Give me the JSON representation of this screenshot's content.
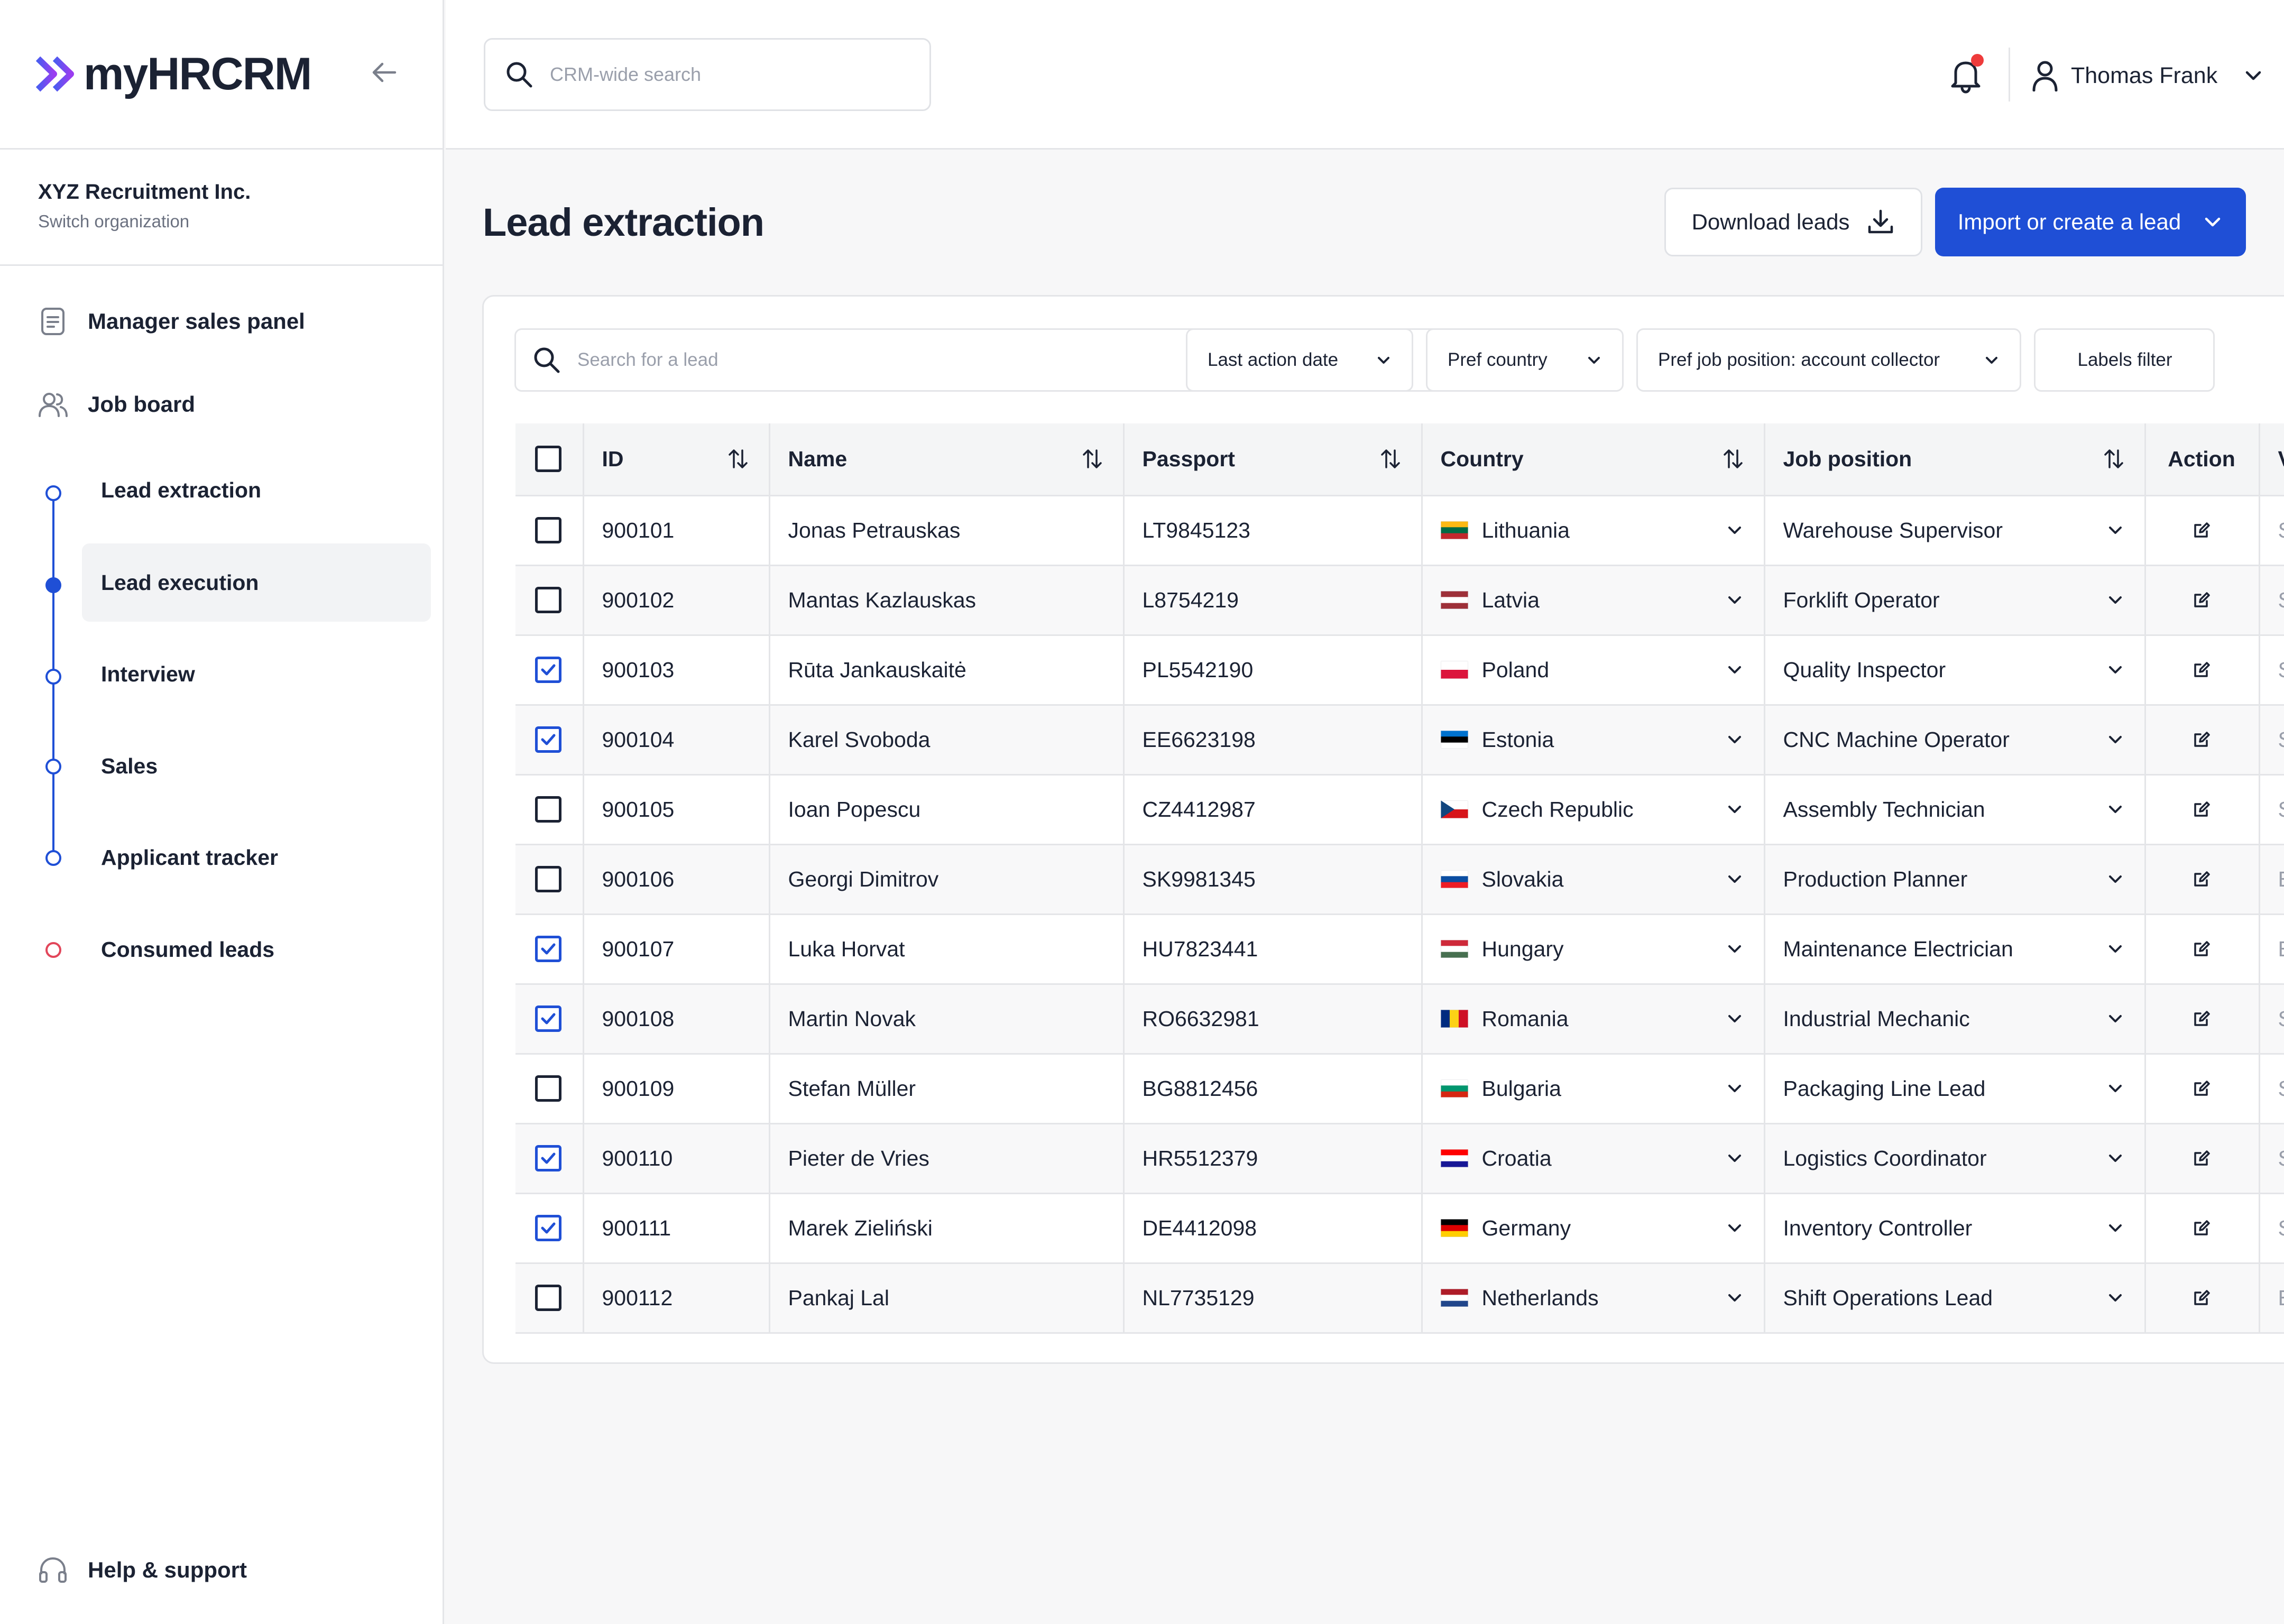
{
  "brand": {
    "name": "myHRCRM"
  },
  "organization": {
    "name": "XYZ Recruitment Inc.",
    "switch_label": "Switch organization"
  },
  "sidebar": {
    "items": [
      {
        "label": "Manager sales panel",
        "icon": "document-icon"
      },
      {
        "label": "Job board",
        "icon": "users-icon"
      }
    ],
    "job_board_steps": [
      {
        "label": "Lead extraction"
      },
      {
        "label": "Lead execution",
        "active": true
      },
      {
        "label": "Interview"
      },
      {
        "label": "Sales"
      },
      {
        "label": "Applicant tracker"
      }
    ],
    "consumed_leads": {
      "label": "Consumed leads"
    },
    "help": {
      "label": "Help & support"
    }
  },
  "topbar": {
    "search_placeholder": "CRM-wide search",
    "user_name": "Thomas Frank"
  },
  "page": {
    "title": "Lead extraction",
    "download_label": "Download leads",
    "import_label": "Import or create a lead"
  },
  "filters": {
    "search_placeholder": "Search for a lead",
    "last_action": "Last action date",
    "pref_country": "Pref country",
    "pref_job": "Pref job position: account collector",
    "labels": "Labels filter"
  },
  "table": {
    "columns": {
      "id": "ID",
      "name": "Name",
      "passport": "Passport",
      "country": "Country",
      "job": "Job position",
      "action": "Action",
      "extra": "V"
    },
    "rows": [
      {
        "id": "900101",
        "name": "Jonas Petrauskas",
        "passport": "LT9845123",
        "country": "Lithuania",
        "job": "Warehouse Supervisor",
        "extra": "S",
        "checked": false
      },
      {
        "id": "900102",
        "name": "Mantas Kazlauskas",
        "passport": "L8754219",
        "country": "Latvia",
        "job": "Forklift Operator",
        "extra": "S",
        "checked": false
      },
      {
        "id": "900103",
        "name": "Rūta Jankauskaitė",
        "passport": "PL5542190",
        "country": "Poland",
        "job": "Quality Inspector",
        "extra": "S",
        "checked": true
      },
      {
        "id": "900104",
        "name": "Karel Svoboda",
        "passport": "EE6623198",
        "country": "Estonia",
        "job": "CNC Machine Operator",
        "extra": "S",
        "checked": true
      },
      {
        "id": "900105",
        "name": "Ioan Popescu",
        "passport": "CZ4412987",
        "country": "Czech Republic",
        "job": "Assembly Technician",
        "extra": "S",
        "checked": false
      },
      {
        "id": "900106",
        "name": "Georgi Dimitrov",
        "passport": "SK9981345",
        "country": "Slovakia",
        "job": "Production Planner",
        "extra": "E",
        "checked": false
      },
      {
        "id": "900107",
        "name": "Luka Horvat",
        "passport": "HU7823441",
        "country": "Hungary",
        "job": "Maintenance Electrician",
        "extra": "E",
        "checked": true
      },
      {
        "id": "900108",
        "name": "Martin Novak",
        "passport": "RO6632981",
        "country": "Romania",
        "job": "Industrial Mechanic",
        "extra": "S",
        "checked": true
      },
      {
        "id": "900109",
        "name": "Stefan Müller",
        "passport": "BG8812456",
        "country": "Bulgaria",
        "job": "Packaging Line Lead",
        "extra": "S",
        "checked": false
      },
      {
        "id": "900110",
        "name": "Pieter de Vries",
        "passport": "HR5512379",
        "country": "Croatia",
        "job": "Logistics Coordinator",
        "extra": "S",
        "checked": true
      },
      {
        "id": "900111",
        "name": "Marek Zieliński",
        "passport": "DE4412098",
        "country": "Germany",
        "job": "Inventory Controller",
        "extra": "S",
        "checked": true
      },
      {
        "id": "900112",
        "name": "Pankaj Lal",
        "passport": "NL7735129",
        "country": "Netherlands",
        "job": "Shift Operations Lead",
        "extra": "E",
        "checked": false
      }
    ]
  },
  "colors": {
    "accent": "#1f4fd6",
    "badge": "#ee3b3b",
    "consumed": "#e2465a"
  }
}
